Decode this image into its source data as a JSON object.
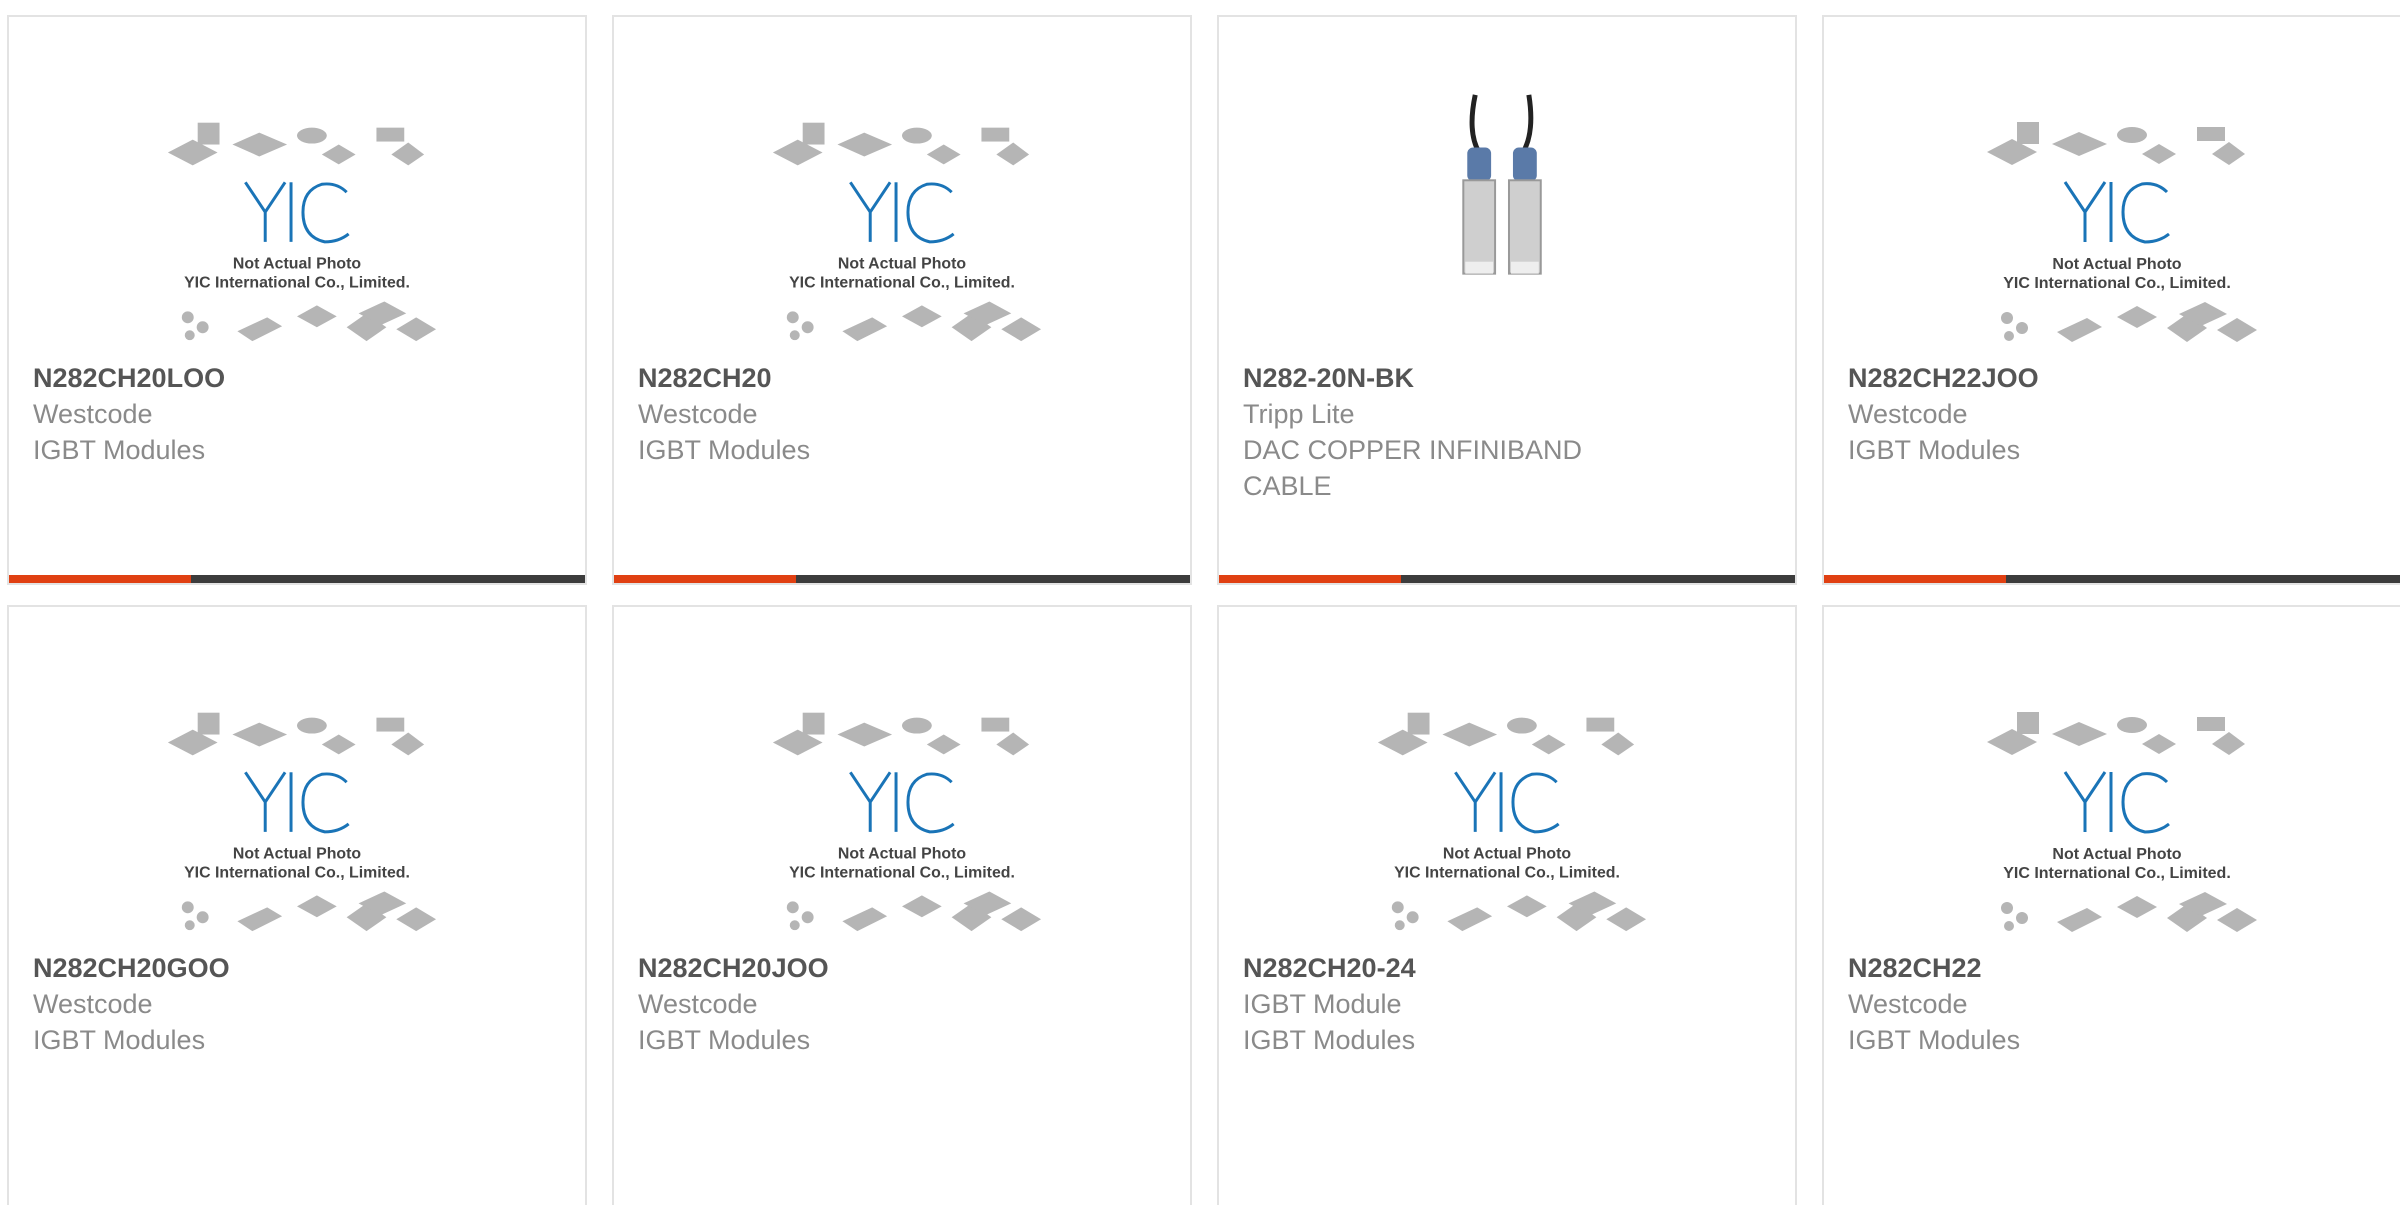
{
  "placeholder": {
    "line1": "Not Actual Photo",
    "line2": "YIC International Co., Limited."
  },
  "colors": {
    "accent": "#e04012",
    "bar": "#3c3c3c",
    "logo": "#1a74b7"
  },
  "products": [
    {
      "part": "N282CH20LOO",
      "line1": "Westcode",
      "line2": "IGBT Modules",
      "line3": "",
      "image": "yic-placeholder-icon"
    },
    {
      "part": "N282CH20",
      "line1": "Westcode",
      "line2": "IGBT Modules",
      "line3": "",
      "image": "yic-placeholder-icon"
    },
    {
      "part": "N282-20N-BK",
      "line1": "Tripp Lite",
      "line2": "DAC COPPER INFINIBAND",
      "line3": "CABLE",
      "image": "dac-cable-photo"
    },
    {
      "part": "N282CH22JOO",
      "line1": "Westcode",
      "line2": "IGBT Modules",
      "line3": "",
      "image": "yic-placeholder-icon"
    },
    {
      "part": "N282CH20GOO",
      "line1": "Westcode",
      "line2": "IGBT Modules",
      "line3": "",
      "image": "yic-placeholder-icon"
    },
    {
      "part": "N282CH20JOO",
      "line1": "Westcode",
      "line2": "IGBT Modules",
      "line3": "",
      "image": "yic-placeholder-icon"
    },
    {
      "part": "N282CH20-24",
      "line1": "IGBT Module",
      "line2": "IGBT Modules",
      "line3": "",
      "image": "yic-placeholder-icon"
    },
    {
      "part": "N282CH22",
      "line1": "Westcode",
      "line2": "IGBT Modules",
      "line3": "",
      "image": "yic-placeholder-icon"
    }
  ]
}
